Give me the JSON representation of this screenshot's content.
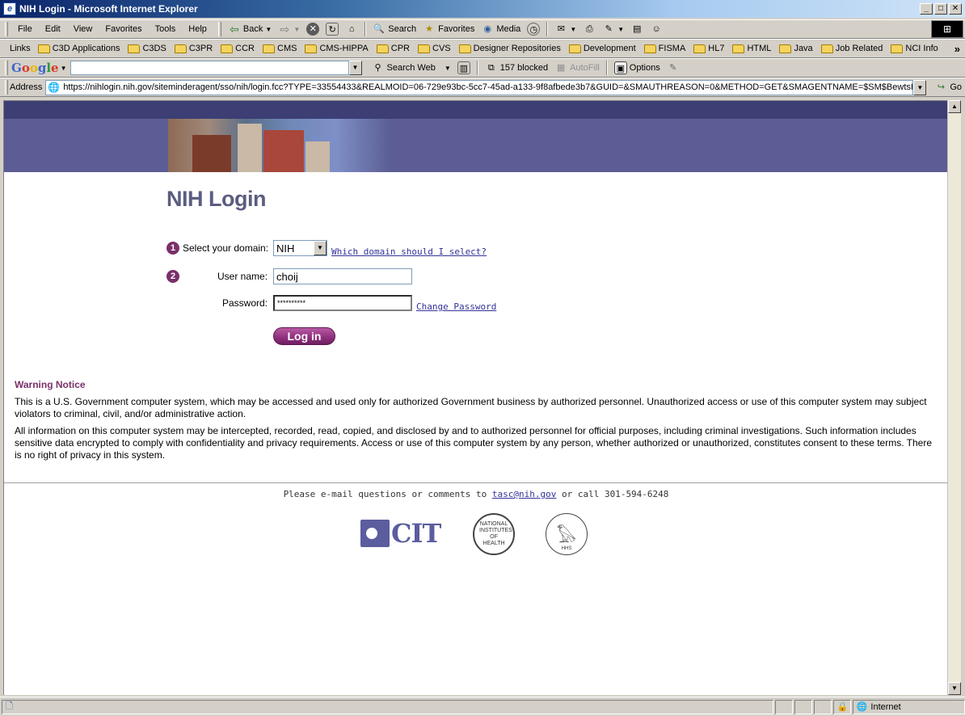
{
  "window": {
    "title": "NIH Login - Microsoft Internet Explorer",
    "controls": [
      "_",
      "□",
      "✕"
    ]
  },
  "menu": [
    "File",
    "Edit",
    "View",
    "Favorites",
    "Tools",
    "Help"
  ],
  "toolbar": {
    "back": "Back",
    "search": "Search",
    "favorites": "Favorites",
    "media": "Media"
  },
  "links": {
    "label": "Links",
    "items": [
      "C3D Applications",
      "C3DS",
      "C3PR",
      "CCR",
      "CMS",
      "CMS-HIPPA",
      "CPR",
      "CVS",
      "Designer Repositories",
      "Development",
      "FISMA",
      "HL7",
      "HTML",
      "Java",
      "Job Related",
      "NCI Info"
    ],
    "more": "»"
  },
  "googlebar": {
    "logo": "Google",
    "search_web": "Search Web",
    "blocked": "157 blocked",
    "autofill": "AutoFill",
    "options": "Options"
  },
  "address": {
    "label": "Address",
    "url": "https://nihlogin.nih.gov/siteminderagent/sso/nih/login.fcc?TYPE=33554433&REALMOID=06-729e93bc-5cc7-45ad-a133-9f8afbede3b7&GUID=&SMAUTHREASON=0&METHOD=GET&SMAGENTNAME=$SM$BewtsHceOK",
    "go": "Go"
  },
  "page": {
    "title": "NIH Login",
    "step1": "1",
    "step2": "2",
    "domain_label": "Select your domain:",
    "domain_value": "NIH",
    "domain_help": "Which domain should I select?",
    "username_label": "User name:",
    "username_value": "choij",
    "password_label": "Password:",
    "password_value": "**********",
    "change_password": "Change Password",
    "login_button": "Log in",
    "warning_title": "Warning Notice",
    "warning_p1": "This is a U.S. Government computer system, which may be accessed and used only for authorized Government business by authorized personnel. Unauthorized access or use of this computer system may subject violators to criminal, civil, and/or administrative action.",
    "warning_p2": "All information on this computer system may be intercepted, recorded, read, copied, and disclosed by and to authorized personnel for official purposes, including criminal investigations. Such information includes sensitive data encrypted to comply with confidentiality and privacy requirements. Access or use of this computer system by any person, whether authorized or unauthorized, constitutes consent to these terms. There is no right of privacy in this system.",
    "footer_prefix": "Please e-mail questions or comments to",
    "footer_email": "tasc@nih.gov",
    "footer_suffix": "or call 301-594-6248",
    "logo_cit": "CIT",
    "seal_nih": "NATIONAL INSTITUTES OF HEALTH",
    "seal_hhs": "HHS"
  },
  "status": {
    "zone": "Internet"
  },
  "colors": {
    "banner": "#5b5d94",
    "accent": "#7a2f6a",
    "title": "#5b5d80"
  }
}
